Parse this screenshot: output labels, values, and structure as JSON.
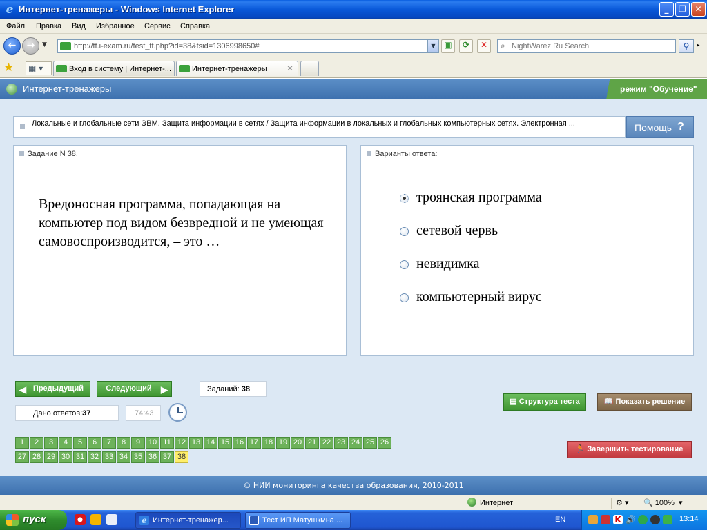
{
  "window": {
    "title": "Интернет-тренажеры - Windows Internet Explorer",
    "minimize": "_",
    "maximize": "❐",
    "close": "✕"
  },
  "menu": [
    "Файл",
    "Правка",
    "Вид",
    "Избранное",
    "Сервис",
    "Справка"
  ],
  "address": {
    "url": "http://tt.i-exam.ru/test_tt.php?id=38&tsid=1306998650#",
    "search_placeholder": "NightWarez.Ru Search"
  },
  "tabs": [
    {
      "label": "Вход в систему | Интернет-...",
      "active": false
    },
    {
      "label": "Интернет-тренажеры",
      "active": true
    }
  ],
  "app": {
    "name": "Интернет-тренажеры",
    "mode": "режим \"Обучение\"",
    "topic": "Локальные и глобальные сети ЭВМ. Защита информации в сетях / Защита информации в локальных и глобальных компьютерных сетях. Электронная ...",
    "help_label": "Помощь",
    "help_glyph": "?"
  },
  "question": {
    "header": "Задание N 38.",
    "text": "Вредоносная программа, попадающая на компьютер под видом безвредной и не умеющая самовоспроизводится, – это …"
  },
  "answers": {
    "header": "Варианты ответа:",
    "options": [
      {
        "label": "троянская программа",
        "selected": true
      },
      {
        "label": "сетевой червь",
        "selected": false
      },
      {
        "label": "невидимка",
        "selected": false
      },
      {
        "label": "компьютерный вирус",
        "selected": false
      }
    ]
  },
  "controls": {
    "prev_label": "Предыдущий",
    "next_label": "Следующий",
    "tasks_label": "Заданий:",
    "tasks_count": "38",
    "answered_label": "Дано ответов:",
    "answered_count": "37",
    "timer": "74:43",
    "structure_label": "Структура теста",
    "solution_label": "Показать решение",
    "finish_label": "Завершить тестирование"
  },
  "question_numbers": {
    "total": 38,
    "current": 38
  },
  "footer": "© НИИ мониторинга качества образования, 2010-2011",
  "statusbar": {
    "zone": "Интернет",
    "zoom": "100%"
  },
  "taskbar": {
    "start_label": "пуск",
    "items": [
      {
        "label": "Интернет-тренажер...",
        "active": true
      },
      {
        "label": "Тест ИП Матушкмна ...",
        "active": false
      }
    ],
    "lang": "EN",
    "clock": "13:14"
  },
  "colors": {
    "accent_blue": "#3d70ae",
    "button_green": "#3f9632",
    "current_question": "#ffef6a",
    "finish_red": "#c23a3f"
  }
}
